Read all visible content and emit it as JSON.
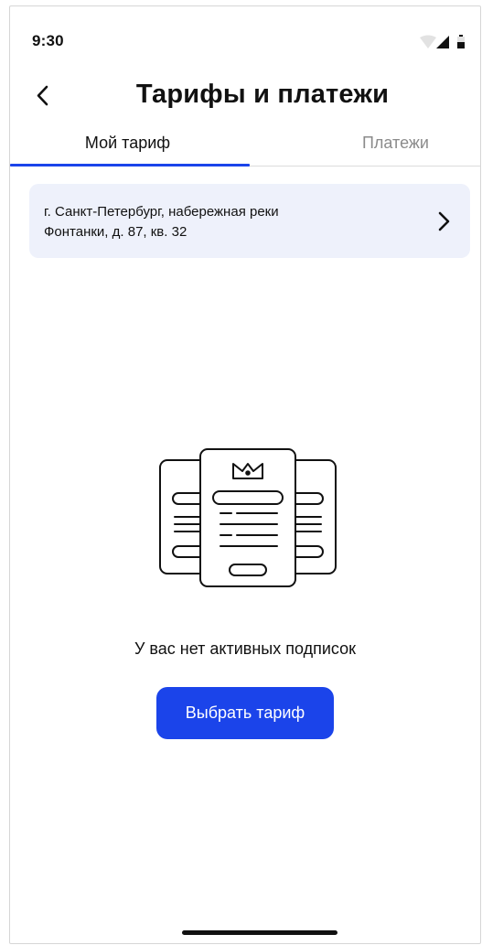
{
  "status_bar": {
    "time": "9:30",
    "icons": [
      "wifi-icon",
      "signal-icon",
      "battery-icon"
    ]
  },
  "header": {
    "title": "Тарифы и платежи",
    "back_icon": "chevron-left-icon"
  },
  "tabs": [
    {
      "label": "Мой тариф",
      "active": true
    },
    {
      "label": "Платежи",
      "active": false
    }
  ],
  "address": {
    "line1": "г. Санкт-Петербург, набережная реки",
    "line2": "Фонтанки, д. 87, кв. 32",
    "icon": "chevron-right-icon"
  },
  "empty_state": {
    "illustration": "tariff-documents-crown-icon",
    "message": "У вас нет активных подписок",
    "button_label": "Выбрать тариф"
  },
  "colors": {
    "accent": "#1b44ea",
    "card_bg": "#eef1fb",
    "inactive_text": "#8b8b8b"
  }
}
